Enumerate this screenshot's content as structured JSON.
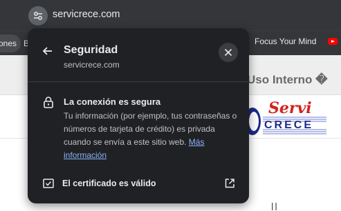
{
  "browser": {
    "url": "servicrece.com",
    "bookmarks": {
      "chip_label": "ones",
      "letter": "B",
      "focus_label": "Focus Your Mind"
    }
  },
  "page": {
    "header_text": "Uso Interno �",
    "logo_text_top": "Servi",
    "logo_text_bottom": "CRECE",
    "bottom_text": "ll"
  },
  "popup": {
    "title": "Seguridad",
    "subtitle": "servicrece.com",
    "connection_title": "La conexión es segura",
    "connection_desc": "Tu información (por ejemplo, tus contraseñas o números de tarjeta de crédito) es privada cuando se envía a este sitio web.",
    "more_info_link": "Más información",
    "certificate_label": "El certificado es válido"
  },
  "colors": {
    "popup_bg": "#202124",
    "link": "#8ab4f8",
    "chrome_bg": "#35363a",
    "logo_red": "#d1241f",
    "logo_blue": "#1c2a8a"
  }
}
